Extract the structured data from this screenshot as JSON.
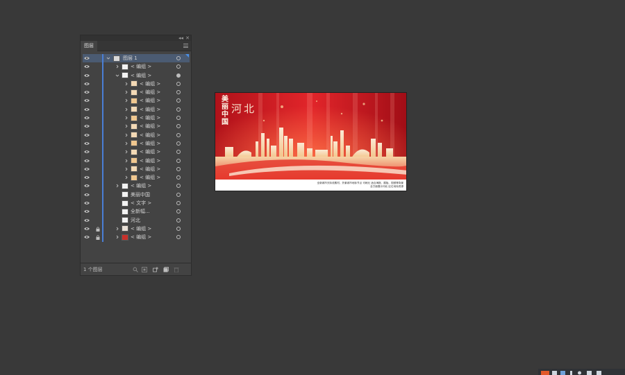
{
  "panel": {
    "tab_label": "图层",
    "collapse_glyph": "◂◂",
    "close_glyph": "✕",
    "footer": {
      "count_text": "1 个图层"
    },
    "layers": [
      {
        "label": "图层 1",
        "indent": 0,
        "expand": "open",
        "selected": true,
        "target_filled": false
      },
      {
        "label": "< 编组 >",
        "indent": 1,
        "expand": "closed",
        "thumb": "#f2f2f2"
      },
      {
        "label": "< 编组 >",
        "indent": 1,
        "expand": "open",
        "target_filled": true,
        "thumb": "#f2f2f2"
      },
      {
        "label": "< 编组 >",
        "indent": 2,
        "expand": "closed",
        "thumb": "#f3d9b5"
      },
      {
        "label": "< 编组 >",
        "indent": 2,
        "expand": "closed",
        "thumb": "#f3d9b5"
      },
      {
        "label": "< 编组 >",
        "indent": 2,
        "expand": "closed",
        "thumb": "#f0c78f"
      },
      {
        "label": "< 编组 >",
        "indent": 2,
        "expand": "closed",
        "thumb": "#f3d9b5"
      },
      {
        "label": "< 编组 >",
        "indent": 2,
        "expand": "closed",
        "thumb": "#f0c78f"
      },
      {
        "label": "< 编组 >",
        "indent": 2,
        "expand": "closed",
        "thumb": "#f3d9b5"
      },
      {
        "label": "< 编组 >",
        "indent": 2,
        "expand": "closed",
        "thumb": "#f3d9b5"
      },
      {
        "label": "< 编组 >",
        "indent": 2,
        "expand": "closed",
        "thumb": "#f0c78f"
      },
      {
        "label": "< 编组 >",
        "indent": 2,
        "expand": "closed",
        "thumb": "#f3d9b5"
      },
      {
        "label": "< 编组 >",
        "indent": 2,
        "expand": "closed",
        "thumb": "#f0c78f"
      },
      {
        "label": "< 编组 >",
        "indent": 2,
        "expand": "closed",
        "thumb": "#f3d9b5"
      },
      {
        "label": "< 编组 >",
        "indent": 2,
        "expand": "closed",
        "thumb": "#f0c78f"
      },
      {
        "label": "< 编组 >",
        "indent": 1,
        "expand": "closed",
        "thumb": "#f2f2f2"
      },
      {
        "label": "美丽中国",
        "indent": 1,
        "expand": "none",
        "thumb": "#f2f2f2"
      },
      {
        "label": "< 文字 >",
        "indent": 1,
        "expand": "none",
        "thumb": "#f2f2f2"
      },
      {
        "label": "全新幅...",
        "indent": 1,
        "expand": "none",
        "thumb": "#f2f2f2"
      },
      {
        "label": "河北",
        "indent": 1,
        "expand": "none",
        "thumb": "#f2f2f2"
      },
      {
        "label": "< 编组 >",
        "indent": 1,
        "expand": "closed",
        "locked": true,
        "thumb": "#e8dfd6"
      },
      {
        "label": "< 编组 >",
        "indent": 1,
        "expand": "closed",
        "locked": true,
        "thumb": "#c8302a"
      }
    ]
  },
  "artboard": {
    "title_vertical": "美丽中国",
    "title_horizontal": "河北",
    "caption_line1": "全新城市天际线素材，外景城市地标节点 可刷元 适合海报、展板、视频等背景",
    "caption_line2": "全方面展示河北 区位地标资源",
    "colors": {
      "red_dark": "#b0121a",
      "red": "#e2252a",
      "gold": "#f2d3a0",
      "cream": "#fbe9d4"
    }
  },
  "colors": {
    "canvas_bg": "#393939",
    "panel_bg": "#434343",
    "accent_blue": "#4a7fd6",
    "selected_row": "#4b5b72"
  }
}
